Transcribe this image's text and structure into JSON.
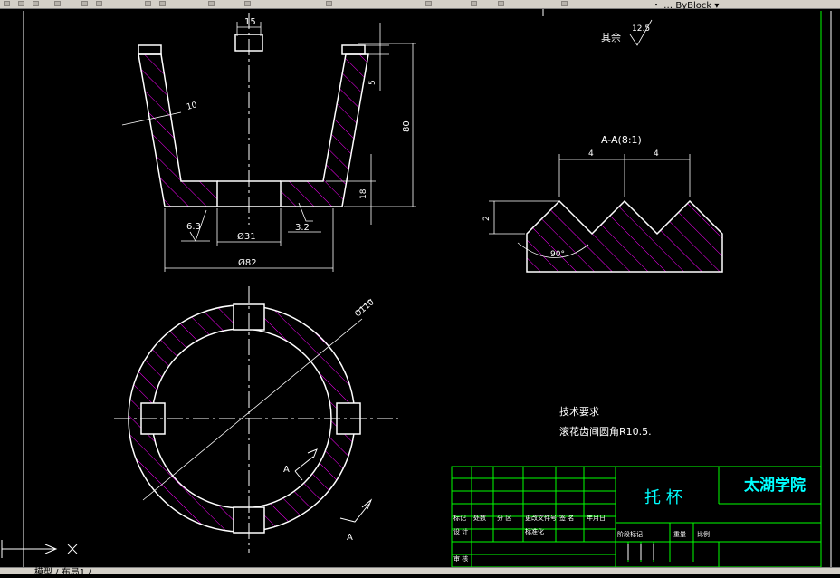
{
  "toolbar": {
    "title_fragment": "・ … ByBlock ▾"
  },
  "command_line": {
    "text": "模型 / 布局1 /"
  },
  "section_view": {
    "dims": {
      "top_width": "15",
      "wall": "10",
      "depth": "5",
      "height": "80",
      "base": "18",
      "d31": "Ø31",
      "d82": "Ø82"
    },
    "roughness_left": "6.3",
    "roughness_right": "3.2"
  },
  "roughness_note": {
    "label": "其余",
    "value": "12.5"
  },
  "detail_view": {
    "title": "A-A(8:1)",
    "pitch_left": "4",
    "pitch_right": "4",
    "height": "2",
    "angle": "90°"
  },
  "plan_view": {
    "dia": "Ø110",
    "section_mark": "A"
  },
  "tech_req": {
    "title": "技术要求",
    "text": "滚花齿间圆角R10.5."
  },
  "title_block": {
    "part_name": "托  杯",
    "school": "太湖学院",
    "row_a": [
      "标记",
      "处数",
      "分 区",
      "更改文件号",
      "签 名",
      "年月日"
    ],
    "row_b": [
      "设 计",
      "",
      "标准化",
      ""
    ],
    "row_c": [
      "审 核"
    ],
    "stage_labels": [
      "阶段标记",
      "重量",
      "比例"
    ]
  },
  "colors": {
    "line": "#ffffff",
    "hatch": "#ff00ff",
    "frame": "#00ff00",
    "text_cyan": "#00ffff"
  }
}
